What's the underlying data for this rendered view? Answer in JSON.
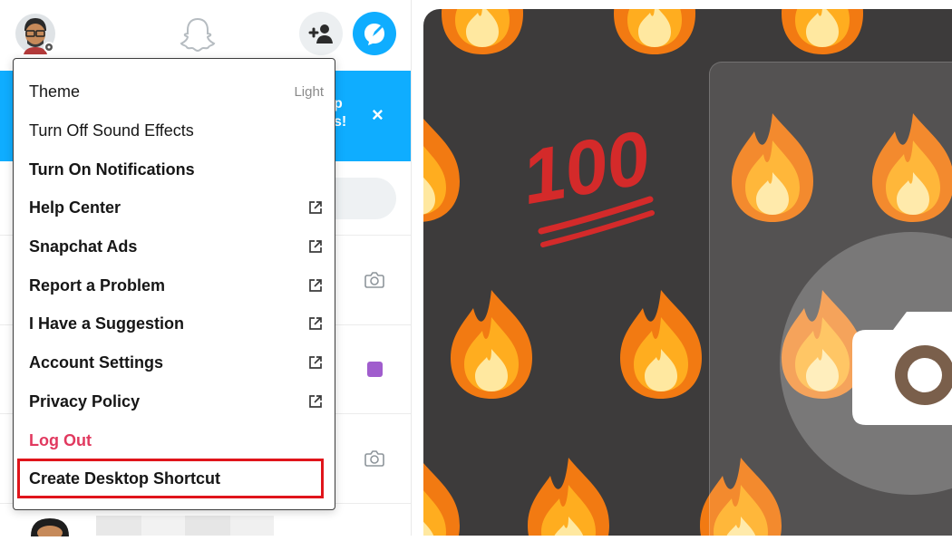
{
  "menu": {
    "items": [
      {
        "label": "Theme",
        "value": "Light",
        "bold": false,
        "external": false
      },
      {
        "label": "Turn Off Sound Effects",
        "bold": false,
        "external": false
      },
      {
        "label": "Turn On Notifications",
        "bold": true,
        "external": false
      },
      {
        "label": "Help Center",
        "bold": true,
        "external": true
      },
      {
        "label": "Snapchat Ads",
        "bold": true,
        "external": true
      },
      {
        "label": "Report a Problem",
        "bold": true,
        "external": true
      },
      {
        "label": "I Have a Suggestion",
        "bold": true,
        "external": true
      },
      {
        "label": "Account Settings",
        "bold": true,
        "external": true
      },
      {
        "label": "Privacy Policy",
        "bold": true,
        "external": true
      },
      {
        "label": "Log Out",
        "bold": true,
        "external": false
      },
      {
        "label": "Create Desktop Shortcut",
        "bold": true,
        "external": false
      }
    ]
  },
  "banner": {
    "line1": "p",
    "line2": "s!",
    "close": "×"
  },
  "right_panel": {
    "big_emoji": "100"
  },
  "icons": {
    "avatar": "bitmoji-avatar-icon",
    "ghost": "snapchat-ghost-icon",
    "add_friend": "add-friend-icon",
    "compose": "new-chat-icon",
    "external": "external-link-icon",
    "camera": "camera-icon"
  },
  "colors": {
    "accent": "#0fadff",
    "logout": "#e1395f",
    "highlight": "#e0151b",
    "chat_badge": "#a05dcd"
  }
}
